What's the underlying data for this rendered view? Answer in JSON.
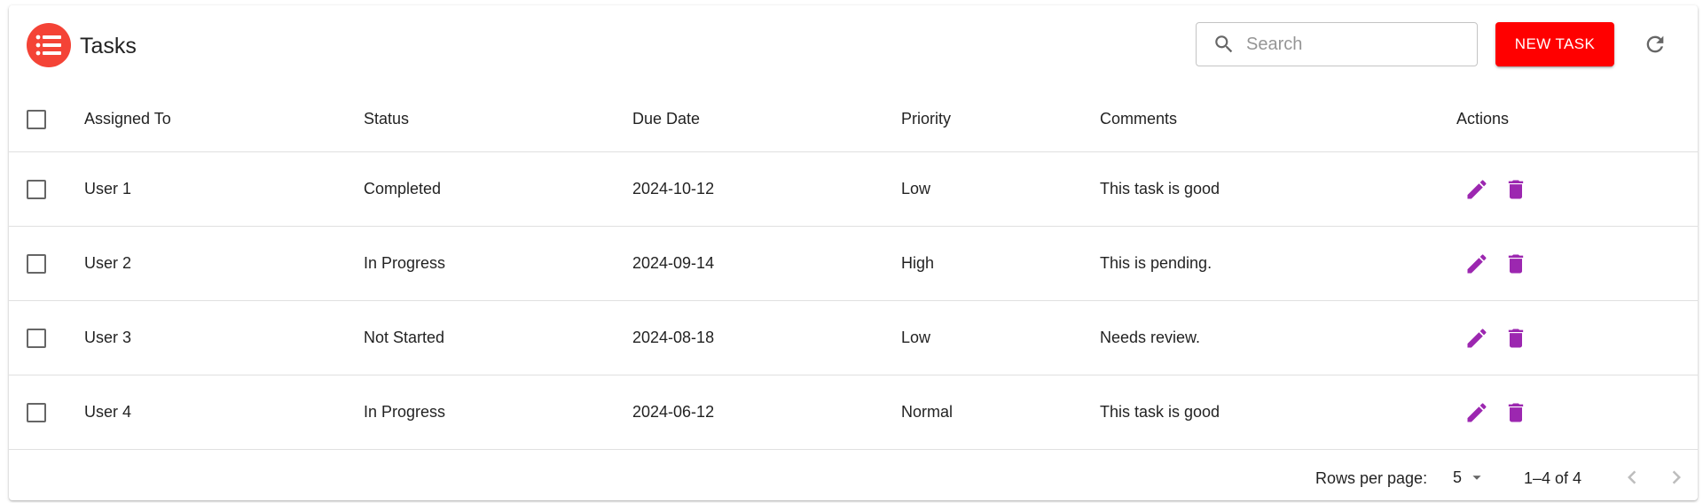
{
  "header": {
    "title": "Tasks",
    "search_placeholder": "Search",
    "new_task_label": "NEW TASK",
    "accent_color": "#ff0000",
    "logo_color": "#f44336"
  },
  "table": {
    "columns": [
      "Assigned To",
      "Status",
      "Due Date",
      "Priority",
      "Comments",
      "Actions"
    ],
    "rows": [
      {
        "assigned_to": "User 1",
        "status": "Completed",
        "due_date": "2024-10-12",
        "priority": "Low",
        "comments": "This task is good"
      },
      {
        "assigned_to": "User 2",
        "status": "In Progress",
        "due_date": "2024-09-14",
        "priority": "High",
        "comments": "This is pending."
      },
      {
        "assigned_to": "User 3",
        "status": "Not Started",
        "due_date": "2024-08-18",
        "priority": "Low",
        "comments": "Needs review."
      },
      {
        "assigned_to": "User 4",
        "status": "In Progress",
        "due_date": "2024-06-12",
        "priority": "Normal",
        "comments": "This task is good"
      }
    ],
    "action_icon_color": "#9c27b0",
    "action_icons": [
      "edit-icon",
      "delete-icon"
    ]
  },
  "pagination": {
    "rows_per_page_label": "Rows per page:",
    "rows_per_page_value": "5",
    "range_label": "1–4 of 4"
  }
}
